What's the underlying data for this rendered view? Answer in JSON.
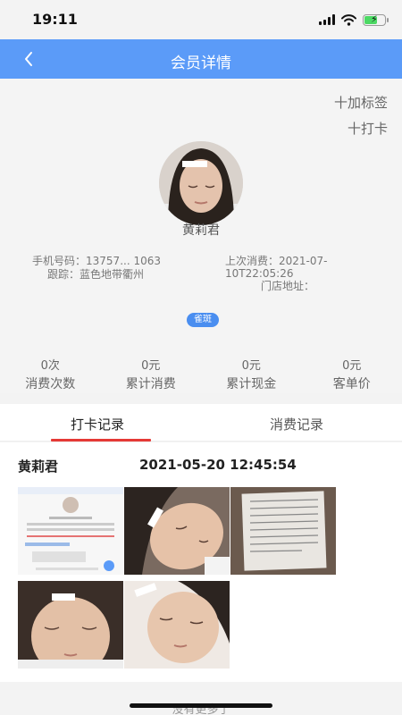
{
  "status_bar": {
    "time": "19:11"
  },
  "header": {
    "title": "会员详情"
  },
  "actions": {
    "add_tag": "十加标签",
    "check_in": "十打卡"
  },
  "member": {
    "name": "黄莉君",
    "phone_label": "手机号码：",
    "phone_value": "13757... 1063",
    "follow_label": "跟踪：",
    "follow_value": "蓝色地带衢州",
    "last_consume_label": "上次消费：",
    "last_consume_value": "2021-07-10T22:05:26",
    "store_address_label": "门店地址：",
    "store_address_value": "",
    "badge": "雀斑"
  },
  "stats": [
    {
      "value": "0次",
      "label": "消费次数"
    },
    {
      "value": "0元",
      "label": "累计消费"
    },
    {
      "value": "0元",
      "label": "累计现金"
    },
    {
      "value": "0元",
      "label": "客单价"
    }
  ],
  "tabs": [
    {
      "label": "打卡记录",
      "active": true
    },
    {
      "label": "消费记录",
      "active": false
    }
  ],
  "record": {
    "name": "黄莉君",
    "time": "2021-05-20 12:45:54",
    "photos": [
      "app-screenshot",
      "face-photo",
      "document-photo",
      "face-photo",
      "face-photo"
    ]
  },
  "footer": {
    "no_more": "没有更多了"
  },
  "colors": {
    "nav_blue": "#5b9bf8",
    "tab_red": "#e53935",
    "badge_blue": "#4a8ef0"
  }
}
